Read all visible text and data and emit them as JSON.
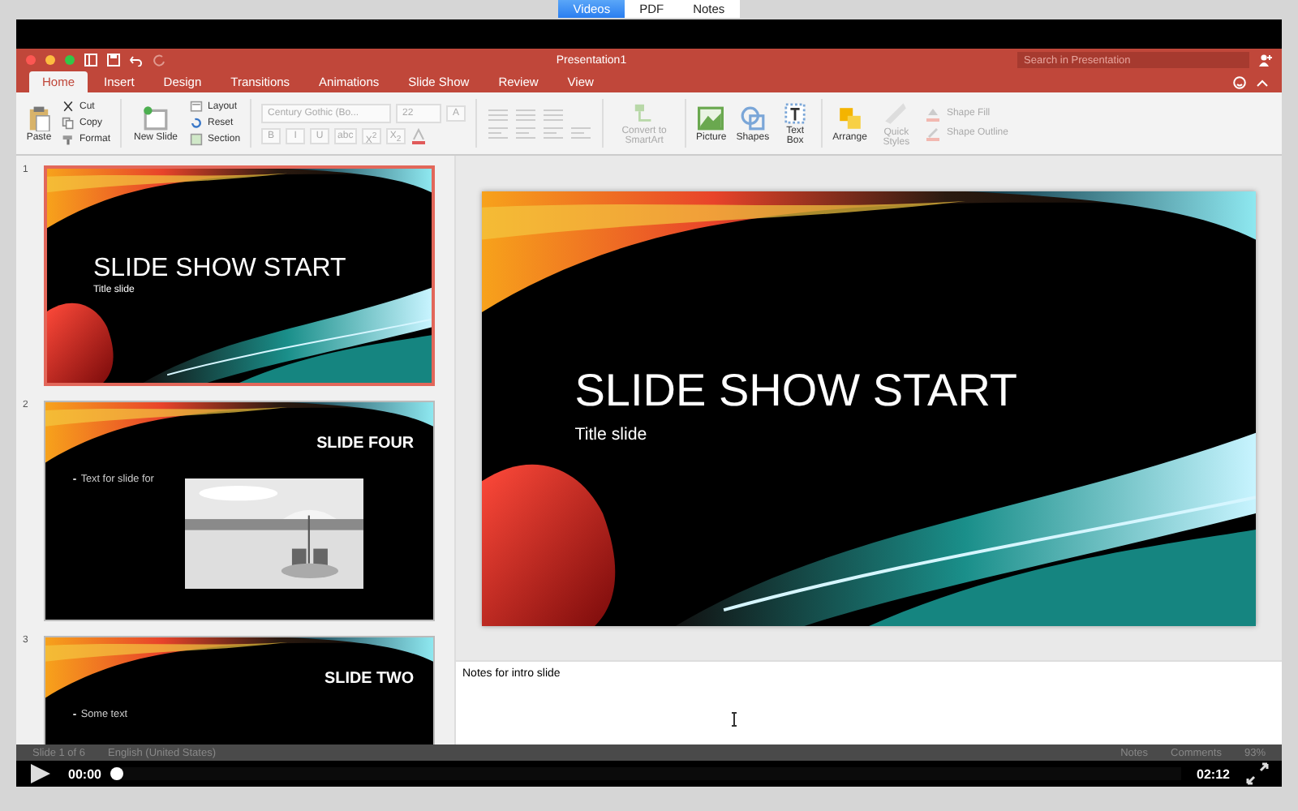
{
  "player_tabs": [
    {
      "label": "Videos",
      "selected": true
    },
    {
      "label": "PDF",
      "selected": false
    },
    {
      "label": "Notes",
      "selected": false
    }
  ],
  "window": {
    "title": "Presentation1",
    "search": {
      "placeholder": "Search in Presentation"
    }
  },
  "ribbon_tabs": [
    {
      "label": "Home",
      "selected": true
    },
    {
      "label": "Insert",
      "selected": false
    },
    {
      "label": "Design",
      "selected": false
    },
    {
      "label": "Transitions",
      "selected": false
    },
    {
      "label": "Animations",
      "selected": false
    },
    {
      "label": "Slide Show",
      "selected": false
    },
    {
      "label": "Review",
      "selected": false
    },
    {
      "label": "View",
      "selected": false
    }
  ],
  "ribbon": {
    "paste": "Paste",
    "cut": "Cut",
    "copy": "Copy",
    "format": "Format",
    "new_slide": "New Slide",
    "layout": "Layout",
    "reset": "Reset",
    "section": "Section",
    "font": {
      "disabled": true,
      "name": "Century Gothic (Bo...",
      "size": "22",
      "grow": "A",
      "styles": [
        "B",
        "I",
        "U",
        "abc",
        "X$^{2}$",
        "X$_{2}$"
      ]
    },
    "paragraph": {
      "disabled": true
    },
    "smartart": {
      "label": "Convert to SmartArt",
      "disabled": true
    },
    "picture": "Picture",
    "shapes": "Shapes",
    "text_box": "Text Box",
    "arrange": "Arrange",
    "quick_styles": {
      "label": "Quick Styles",
      "disabled": true
    },
    "shape_fill": {
      "label": "Shape Fill",
      "disabled": true
    },
    "shape_outline": {
      "label": "Shape Outline",
      "disabled": true
    }
  },
  "slides": [
    {
      "number": "1",
      "selected": true,
      "kind": "title",
      "title": "SLIDE SHOW START",
      "subtitle": "Title slide"
    },
    {
      "number": "2",
      "selected": false,
      "kind": "content_picture",
      "title": "SLIDE FOUR",
      "bullet": "Text for slide for"
    },
    {
      "number": "3",
      "selected": false,
      "kind": "content",
      "title": "SLIDE TWO",
      "bullet": "Some text"
    }
  ],
  "main_slide": {
    "kind": "title",
    "title": "SLIDE SHOW START",
    "subtitle": "Title slide"
  },
  "notes": "Notes for intro slide",
  "status_bar": {
    "slide": "Slide 1 of 6",
    "language": "English (United States)",
    "notes": "Notes",
    "comments": "Comments",
    "zoom": "93%"
  },
  "player": {
    "elapsed": "00:00",
    "total": "02:12",
    "level": 0
  }
}
